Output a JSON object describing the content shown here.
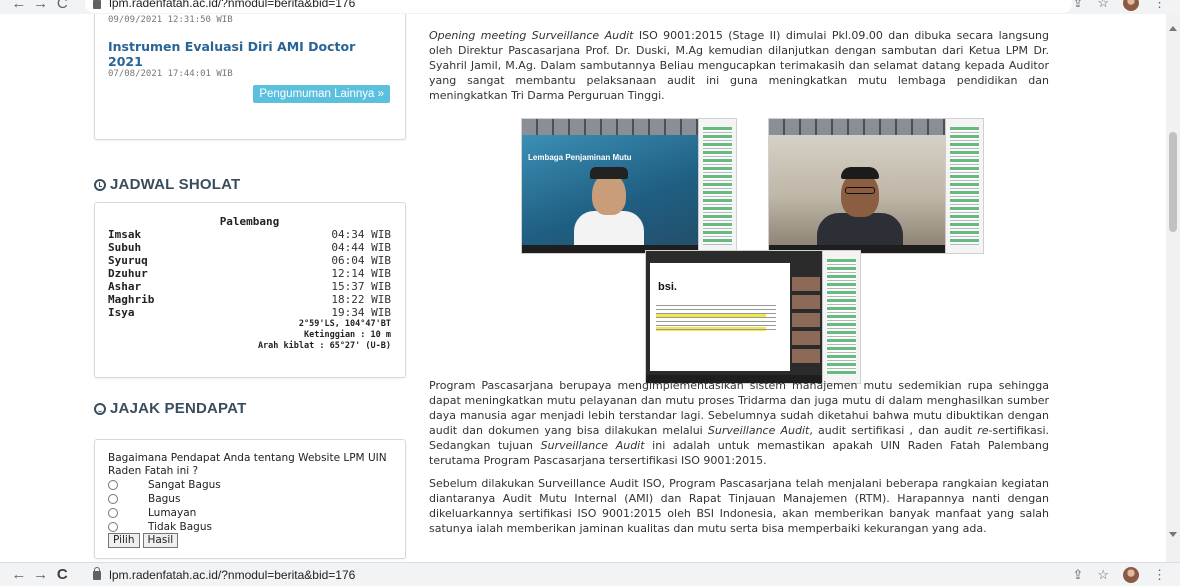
{
  "browser": {
    "url": "lpm.radenfatah.ac.id/?nmodul=berita&bid=176",
    "top_url_partial": "lpm.radenfatah.ac.id/?nmodul=berita&bid=176"
  },
  "announcements": {
    "item1_date": "09/09/2021 12:31:50 WIB",
    "item2_title": "Instrumen Evaluasi Diri AMI Doctor 2021",
    "item2_date": "07/08/2021 17:44:01 WIB",
    "more_button": "Pengumuman Lainnya »"
  },
  "jadwal_sholat": {
    "title": "JADWAL SHOLAT",
    "city": "Palembang",
    "times": [
      {
        "name": "Imsak",
        "time": "04:34 WIB"
      },
      {
        "name": "Subuh",
        "time": "04:44 WIB"
      },
      {
        "name": "Syuruq",
        "time": "06:04 WIB"
      },
      {
        "name": "Dzuhur",
        "time": "12:14 WIB"
      },
      {
        "name": "Ashar",
        "time": "15:37 WIB"
      },
      {
        "name": "Maghrib",
        "time": "18:22 WIB"
      },
      {
        "name": "Isya",
        "time": "19:34 WIB"
      }
    ],
    "coords": "2°59'LS, 104°47'BT",
    "altitude": "Ketinggian : 10 m",
    "qibla": "Arah kiblat : 65°27' (U-B)"
  },
  "poll": {
    "title": "JAJAK PENDAPAT",
    "question": "Bagaimana Pendapat Anda tentang Website LPM UIN Raden Fatah ini ?",
    "options": [
      "Sangat Bagus",
      "Bagus",
      "Lumayan",
      "Tidak Bagus"
    ],
    "submit": "Pilih",
    "results": "Hasil"
  },
  "article": {
    "p1_italic": "Opening meeting Surveillance Audit",
    "p1_rest": " ISO 9001:2015 (Stage II) dimulai Pkl.09.00 dan dibuka secara langsung oleh Direktur Pascasarjana Prof. Dr. Duski, M.Ag kemudian dilanjutkan dengan sambutan dari Ketua LPM Dr. Syahril Jamil, M.Ag. Dalam sambutannya Beliau mengucapkan terimakasih dan selamat datang kepada Auditor yang sangat membantu pelaksanaan audit ini guna meningkatkan mutu lembaga pendidikan dan meningkatkan Tri Darma Perguruan Tinggi.",
    "p2_a": "Program Pascasarjana berupaya mengimplementasikan sistem manajemen mutu sedemikian rupa sehingga dapat meningkatkan mutu pelayanan dan mutu proses Tridarma dan juga mutu di dalam menghasilkan sumber daya manusia agar menjadi lebih terstandar lagi. Sebelumnya sudah diketahui bahwa mutu dibuktikan dengan audit dan dokumen yang bisa dilakukan melalui ",
    "p2_b_italic": "Surveillance Audit",
    "p2_c": ", audit sertifikasi , dan audit ",
    "p2_d_italic": "re",
    "p2_e": "-sertifikasi. Sedangkan tujuan ",
    "p2_f_italic": "Surveillance Audit",
    "p2_g": " ini adalah untuk memastikan apakah UIN Raden Fatah Palembang terutama Program Pascasarjana tersertifikasi ISO 9001:2015.",
    "p3": "Sebelum dilakukan Surveillance Audit ISO, Program Pascasarjana telah menjalani beberapa rangkaian kegiatan diantaranya Audit Mutu Internal (AMI) dan Rapat Tinjauan Manajemen (RTM). Harapannya nanti dengan dikeluarkannya sertifikasi ISO 9001:2015 oleh BSI Indonesia, akan memberikan banyak manfaat yang salah satunya ialah memberikan jaminan kualitas dan mutu serta bisa memperbaiki kekurangan yang ada.",
    "img1_banner": "Lembaga Penjaminan Mutu",
    "img3_logo": "bsi."
  }
}
